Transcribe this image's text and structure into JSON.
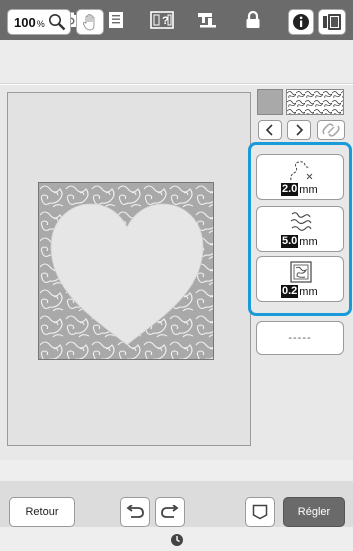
{
  "topbar": {
    "icons": [
      "wifi-icon",
      "camera-icon",
      "document-icon",
      "help-icon",
      "sewing-machine-icon",
      "lock-icon",
      "home-icon"
    ]
  },
  "toolbar": {
    "zoom_value": "100",
    "zoom_unit": "%",
    "icons": [
      "magnifier-icon",
      "hand-icon",
      "info-icon",
      "screen-icon"
    ]
  },
  "side": {
    "swatch_color": "#a9a9a9",
    "nav_icons": [
      "arrow-left-icon",
      "arrow-right-icon",
      "link-icon"
    ]
  },
  "params": [
    {
      "icon": "stitch-length-icon",
      "value": "2.0",
      "unit": "mm"
    },
    {
      "icon": "stippling-distance-icon",
      "value": "5.0",
      "unit": "mm"
    },
    {
      "icon": "offset-icon",
      "value": "0.2",
      "unit": "mm"
    }
  ],
  "extra_param": "-----",
  "bottom": {
    "back_label": "Retour",
    "set_label": "Régler",
    "icons": [
      "undo-icon",
      "redo-icon",
      "shape-icon",
      "clock-icon"
    ]
  },
  "colors": {
    "accent": "#1a9ad8",
    "topbar": "#6b6b6b",
    "pattern_fill": "#a9a9a9",
    "set_button": "#6a6a6a"
  }
}
